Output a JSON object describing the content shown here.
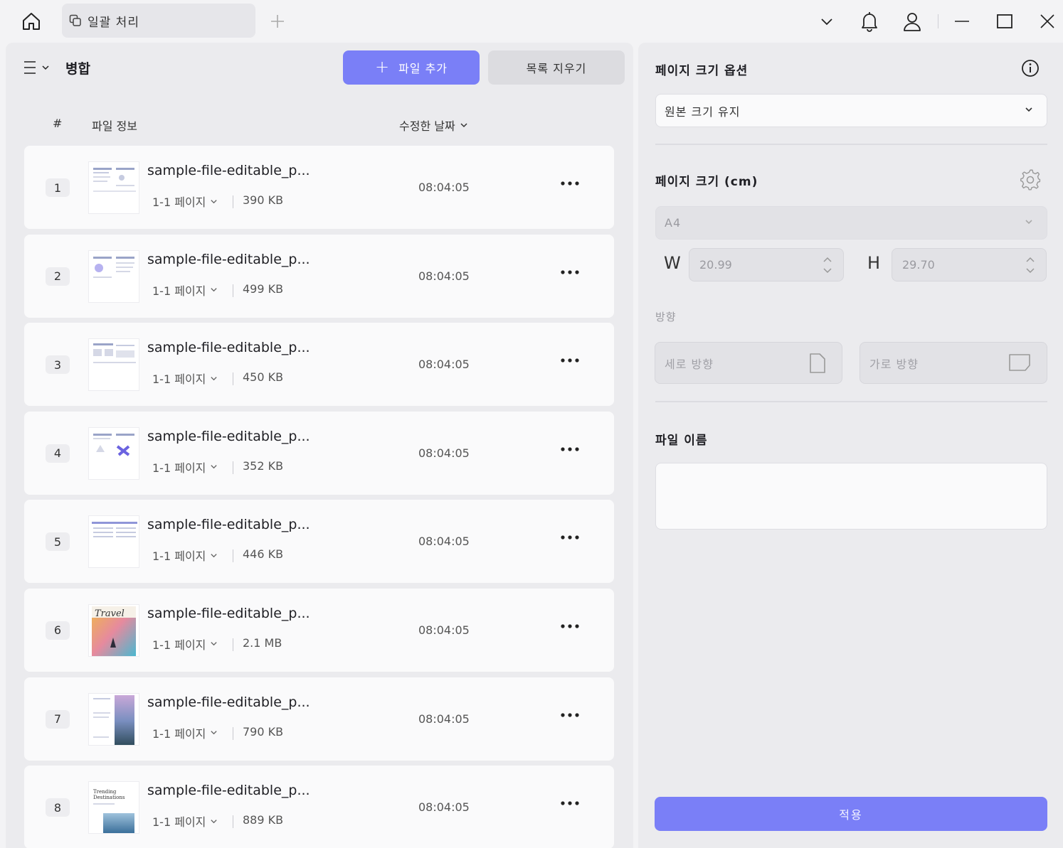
{
  "titlebar": {
    "tab_label": "일괄 처리",
    "icons": [
      "home-icon",
      "copy-icon",
      "plus-icon",
      "chevron-down-icon",
      "bell-icon",
      "user-icon",
      "minimize-icon",
      "maximize-icon",
      "close-icon"
    ]
  },
  "left": {
    "title": "병합",
    "add_file": "파일 추가",
    "clear_list": "목록 지우기",
    "columns": {
      "number": "#",
      "file_info": "파일 정보",
      "modified_date": "수정한 날짜"
    }
  },
  "files": [
    {
      "num": "1",
      "name": "sample-file-editable_p...",
      "pages": "1-1 페이지",
      "size": "390 KB",
      "time": "08:04:05"
    },
    {
      "num": "2",
      "name": "sample-file-editable_p...",
      "pages": "1-1 페이지",
      "size": "499 KB",
      "time": "08:04:05"
    },
    {
      "num": "3",
      "name": "sample-file-editable_p...",
      "pages": "1-1 페이지",
      "size": "450 KB",
      "time": "08:04:05"
    },
    {
      "num": "4",
      "name": "sample-file-editable_p...",
      "pages": "1-1 페이지",
      "size": "352 KB",
      "time": "08:04:05"
    },
    {
      "num": "5",
      "name": "sample-file-editable_p...",
      "pages": "1-1 페이지",
      "size": "446 KB",
      "time": "08:04:05"
    },
    {
      "num": "6",
      "name": "sample-file-editable_p...",
      "pages": "1-1 페이지",
      "size": "2.1 MB",
      "time": "08:04:05"
    },
    {
      "num": "7",
      "name": "sample-file-editable_p...",
      "pages": "1-1 페이지",
      "size": "790 KB",
      "time": "08:04:05"
    },
    {
      "num": "8",
      "name": "sample-file-editable_p...",
      "pages": "1-1 페이지",
      "size": "889 KB",
      "time": "08:04:05"
    }
  ],
  "right": {
    "page_size_options_title": "페이지 크기 옵션",
    "page_size_option_value": "원본 크기 유지",
    "page_size_title": "페이지 크기 (cm)",
    "paper_value": "A4",
    "w_label": "W",
    "w_value": "20.99",
    "h_label": "H",
    "h_value": "29.70",
    "orientation_label": "방향",
    "portrait": "세로 방향",
    "landscape": "가로 방향",
    "file_name_label": "파일 이름",
    "file_name_value": "",
    "apply": "적용"
  },
  "colors": {
    "accent": "#7a7ff7",
    "panel": "#ebebee",
    "card": "#fafafb"
  }
}
